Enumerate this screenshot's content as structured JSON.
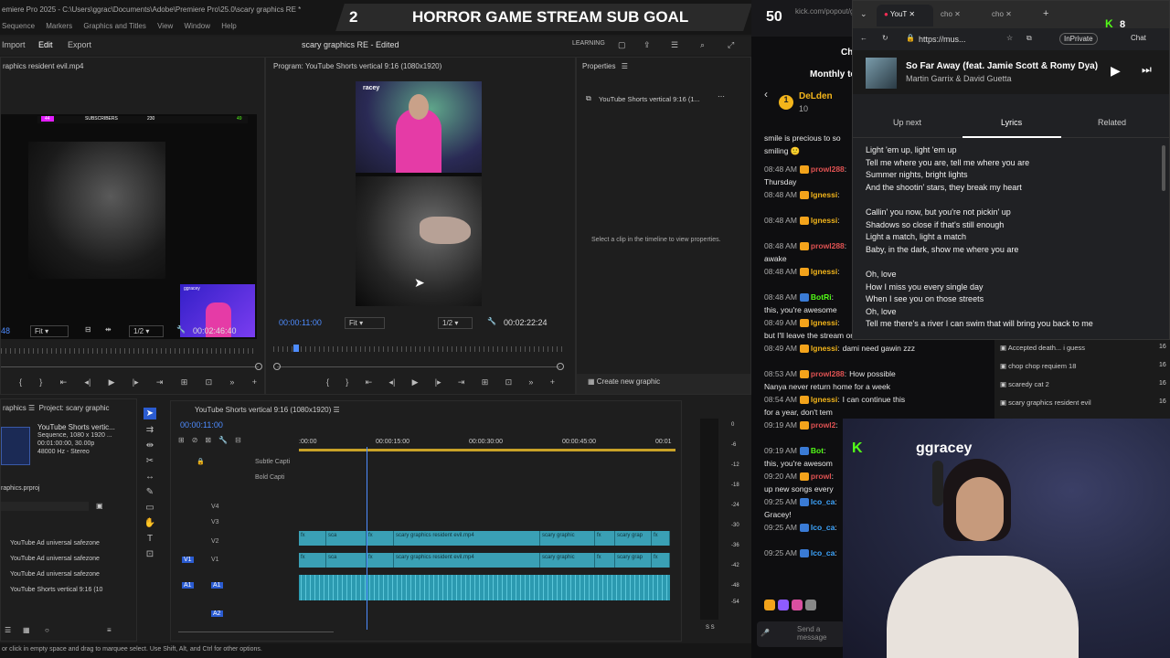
{
  "premiere": {
    "title_path": "emiere Pro 2025 - C:\\Users\\ggrac\\Documents\\Adobe\\Premiere Pro\\25.0\\scary graphics RE *",
    "menu": [
      "Sequence",
      "Markers",
      "Graphics and Titles",
      "View",
      "Window",
      "Help"
    ],
    "tabs": {
      "import": "Import",
      "edit": "Edit",
      "export": "Export"
    },
    "project_name": "scary graphics RE - Edited",
    "learning": "LEARNING",
    "source_panel": {
      "title": "raphics resident evil.mp4",
      "fit": "Fit",
      "ratio": "1/2",
      "timecode": "00:02:46:40",
      "left_tc": "48"
    },
    "source_overlay": {
      "subscribers": "SUBSCRIBERS",
      "sub_count": "230",
      "sub_left": "44",
      "sub_right": "49",
      "name": "ggracey"
    },
    "program_panel": {
      "title": "Program: YouTube Shorts vertical 9:16 (1080x1920)",
      "timecode": "00:00:11:00",
      "fit": "Fit",
      "ratio": "1/2",
      "duration": "00:02:22:24",
      "overlay_name": "racey"
    },
    "properties_panel": {
      "title": "Properties",
      "item": "YouTube Shorts vertical 9:16 (1...",
      "empty_msg": "Select a clip in the timeline to view properties.",
      "create_graphic": "Create new graphic"
    },
    "project_panel": {
      "tab1": "raphics",
      "tab2": "Project: scary graphic",
      "seq_name": "YouTube Shorts vertic...",
      "seq_info": [
        "Sequence, 1080 x 1920 ...",
        "00:01:00:00, 30.00p",
        "48000 Hz - Stereo"
      ],
      "file": "raphics.prproj",
      "items": [
        "YouTube Ad universal safezone",
        "YouTube Ad universal safezone",
        "YouTube Ad universal safezone",
        "YouTube Shorts vertical 9:16 (10"
      ]
    },
    "timeline": {
      "title": "YouTube Shorts vertical 9:16 (1080x1920)",
      "timecode": "00:00:11:00",
      "ruler": [
        ":00:00",
        "00:00:15:00",
        "00:00:30:00",
        "00:00:45:00",
        "00:01"
      ],
      "tracks": {
        "subtle": "Subtle Capti",
        "bold": "Bold Capti",
        "v4": "V4",
        "v3": "V3",
        "v2": "V2",
        "v1": "V1",
        "a1": "A1",
        "a2": "A2",
        "left_v1": "V1",
        "left_a1": "A1"
      },
      "clips": [
        "fx",
        "sca",
        "fx",
        "scary graphics resident evil.mp4",
        "scary graphic",
        "fx",
        "scary grap",
        "fx"
      ],
      "meter": [
        "0",
        "-6",
        "-12",
        "-18",
        "-24",
        "-30",
        "-36",
        "-42",
        "-48",
        "-54"
      ],
      "meter_foot": "S S"
    },
    "status": "or click in empty space and drag to marquee select. Use Shift, Alt, and Ctrl for other options."
  },
  "stream": {
    "goal": "HORROR GAME STREAM SUB GOAL",
    "goal_current": "2",
    "goal_target": "50"
  },
  "chat": {
    "url": "kick.com/popout/gg",
    "ch_label": "Ch",
    "monthly": "Monthly to",
    "top_user": "DeLden",
    "top_amount": "10",
    "first_line": "smile is precious to so",
    "first_line2": "smiling 🙂",
    "messages": [
      {
        "time": "08:48 AM",
        "user": "prowl288",
        "text": "",
        "cont": "Thursday",
        "color": "red"
      },
      {
        "time": "08:48 AM",
        "user": "lgnessi",
        "text": "",
        "cont": "",
        "color": "yel"
      },
      {
        "time": "08:48 AM",
        "user": "lgnessi",
        "text": "",
        "cont": "",
        "color": "yel"
      },
      {
        "time": "08:48 AM",
        "user": "prowl288",
        "text": "",
        "cont": "awake",
        "color": "red"
      },
      {
        "time": "08:48 AM",
        "user": "lgnessi",
        "text": "",
        "cont": "",
        "color": "yel"
      },
      {
        "time": "08:48 AM",
        "user": "BotRi",
        "text": "",
        "cont": "this, you're awesome",
        "color": "grn"
      },
      {
        "time": "08:49 AM",
        "user": "lgnessi",
        "text": "",
        "cont": "but I'll leave the stream on",
        "color": "yel"
      },
      {
        "time": "08:49 AM",
        "user": "lgnessi",
        "text": "dami need gawin zzz",
        "cont": "",
        "color": "yel"
      },
      {
        "time": "08:53 AM",
        "user": "prowl288",
        "text": "How possible",
        "cont": "Nanya never return home for a week",
        "color": "red"
      },
      {
        "time": "08:54 AM",
        "user": "lgnessi",
        "text": "I can continue this",
        "cont": "for a year, don't tem",
        "color": "yel"
      },
      {
        "time": "09:19 AM",
        "user": "prowl2",
        "text": "",
        "cont": "",
        "color": "red"
      },
      {
        "time": "09:19 AM",
        "user": "Bot",
        "text": "",
        "cont": "this, you're awesom",
        "color": "grn"
      },
      {
        "time": "09:20 AM",
        "user": "prowl",
        "text": "",
        "cont": "up new songs every",
        "color": "red"
      },
      {
        "time": "09:25 AM",
        "user": "lco_ca",
        "text": "",
        "cont": "Gracey!",
        "color": "blu"
      },
      {
        "time": "09:25 AM",
        "user": "lco_ca",
        "text": "",
        "cont": "",
        "color": "blu"
      },
      {
        "time": "09:25 AM",
        "user": "lco_ca",
        "text": "",
        "cont": "",
        "color": "blu"
      }
    ],
    "send_placeholder": "Send a message"
  },
  "browser": {
    "tabs": [
      "YouT",
      "cho",
      "cho"
    ],
    "url": "https://mus...",
    "inprivate": "InPrivate",
    "chat_btn": "Chat",
    "kick_count": "8",
    "song": "So Far Away (feat. Jamie Scott & Romy Dya)",
    "artist": "Martin Garrix & David Guetta",
    "tabs2": [
      "Up next",
      "Lyrics",
      "Related"
    ],
    "lyrics": [
      "Light 'em up, light 'em up",
      "Tell me where you are, tell me where you are",
      "Summer nights, bright lights",
      "And the shootin' stars, they break my heart",
      "",
      "Callin' you now, but you're not pickin' up",
      "Shadows so close if that's still enough",
      "Light a match, light a match",
      "Baby, in the dark, show me where you are",
      "",
      "Oh, love",
      "How I miss you every single day",
      "When I see you on those streets",
      "Oh, love",
      "Tell me there's a river I can swim that will bring you back to me"
    ]
  },
  "side_list": {
    "items": [
      "Accepted death... i guess",
      "chop chop requiem 18",
      "scaredy cat 2",
      "scary graphics resident evil"
    ],
    "nums": [
      "16",
      "16",
      "16",
      "16"
    ]
  },
  "webcam": {
    "name": "ggracey"
  }
}
